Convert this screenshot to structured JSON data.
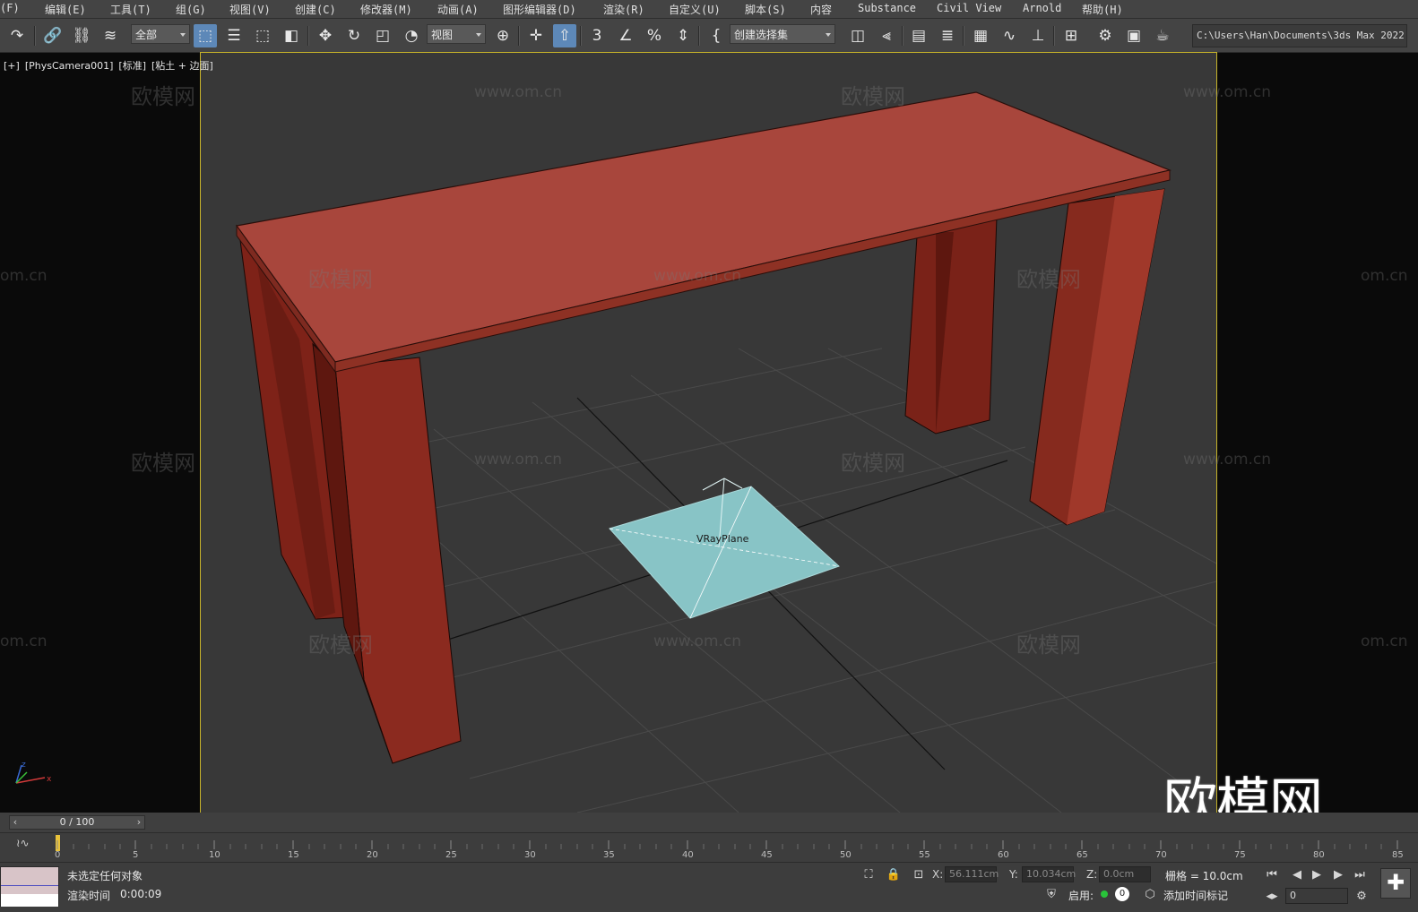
{
  "menu": {
    "items": [
      "(F)",
      "编辑(E)",
      "工具(T)",
      "组(G)",
      "视图(V)",
      "创建(C)",
      "修改器(M)",
      "动画(A)",
      "图形编辑器(D)",
      "渲染(R)",
      "自定义(U)",
      "脚本(S)",
      "内容",
      "Substance",
      "Civil View",
      "Arnold",
      "帮助(H)"
    ]
  },
  "toolbar": {
    "filter_label": "全部",
    "coord_label": "视图",
    "selection_set_label": "创建选择集",
    "path": "C:\\Users\\Han\\Documents\\3ds Max 2022"
  },
  "viewport": {
    "label_plus": "[+]",
    "label_camera": "[PhysCamera001]",
    "label_mode": "[标准]",
    "label_shading": "[粘土 + 边面]",
    "object_label": "VRayPlane",
    "axis_x": "x",
    "axis_z": "z",
    "colors": {
      "table": "#a8463c",
      "table_leg": "#7e2218",
      "plane": "#88c4c6",
      "active_border": "#c7b32a"
    }
  },
  "watermark": {
    "text": "欧模网",
    "url": "www.om.cn",
    "url_cut": "om.cn",
    "logo": "欧模网"
  },
  "time": {
    "slider": "0 / 100",
    "ticks": [
      "0",
      "5",
      "10",
      "15",
      "20",
      "25",
      "30",
      "35",
      "40",
      "45",
      "50",
      "55",
      "60",
      "65",
      "70",
      "75",
      "80",
      "85"
    ]
  },
  "status": {
    "selection": "未选定任何对象",
    "render_time_label": "渲染时间",
    "render_time_value": "0:00:09",
    "x_label": "X:",
    "x_value": "56.111cm",
    "y_label": "Y:",
    "y_value": "10.034cm",
    "z_label": "Z:",
    "z_value": "0.0cm",
    "grid_label": "栅格 = 10.0cm",
    "enable_label": "启用:",
    "enable_count": "0",
    "add_time_tag": "添加时间标记",
    "frame_value": "0"
  }
}
